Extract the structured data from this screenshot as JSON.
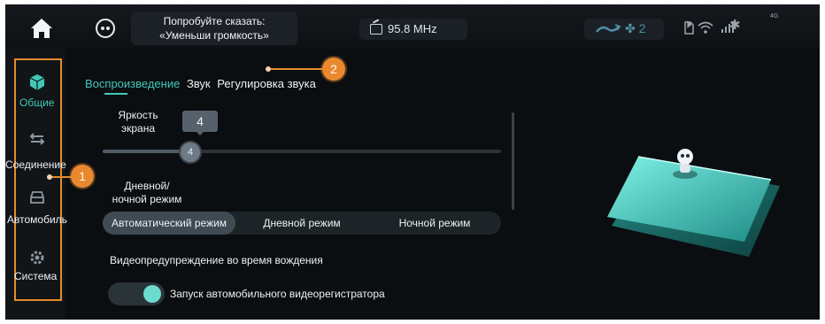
{
  "topbar": {
    "voice_hint_line1": "Попробуйте сказать:",
    "voice_hint_line2": "«Уменьши громкость»",
    "radio": "95.8 MHz",
    "fan_level": "2",
    "signal_label": "4G"
  },
  "sidebar": {
    "items": [
      {
        "label": "Общие",
        "icon": "cube-icon",
        "active": true
      },
      {
        "label": "Соединение",
        "icon": "transfer-icon",
        "active": false
      },
      {
        "label": "Автомобиль",
        "icon": "car-icon",
        "active": false
      },
      {
        "label": "Система",
        "icon": "gear-icon",
        "active": false
      }
    ]
  },
  "tabs": {
    "active": "Воспроизведение",
    "sound": "Звук",
    "volume": "Регулировка звука"
  },
  "brightness": {
    "label_line1": "Яркость",
    "label_line2": "экрана",
    "value": "4",
    "fraction": 0.22
  },
  "daynight": {
    "label_line1": "Дневной/",
    "label_line2": "ночной режим",
    "options": [
      "Автоматический режим",
      "Дневной режим",
      "Ночной режим"
    ],
    "selected": "Автоматический режим"
  },
  "video": {
    "heading": "Видеопредупреждение во время вождения",
    "toggle_label": "Запуск автомобильного видеорегистратора",
    "enabled": true
  },
  "callouts": [
    "1",
    "2"
  ],
  "colors": {
    "accent": "#41c7b7",
    "callout": "#e9892f",
    "frame": "#e68a2e"
  }
}
